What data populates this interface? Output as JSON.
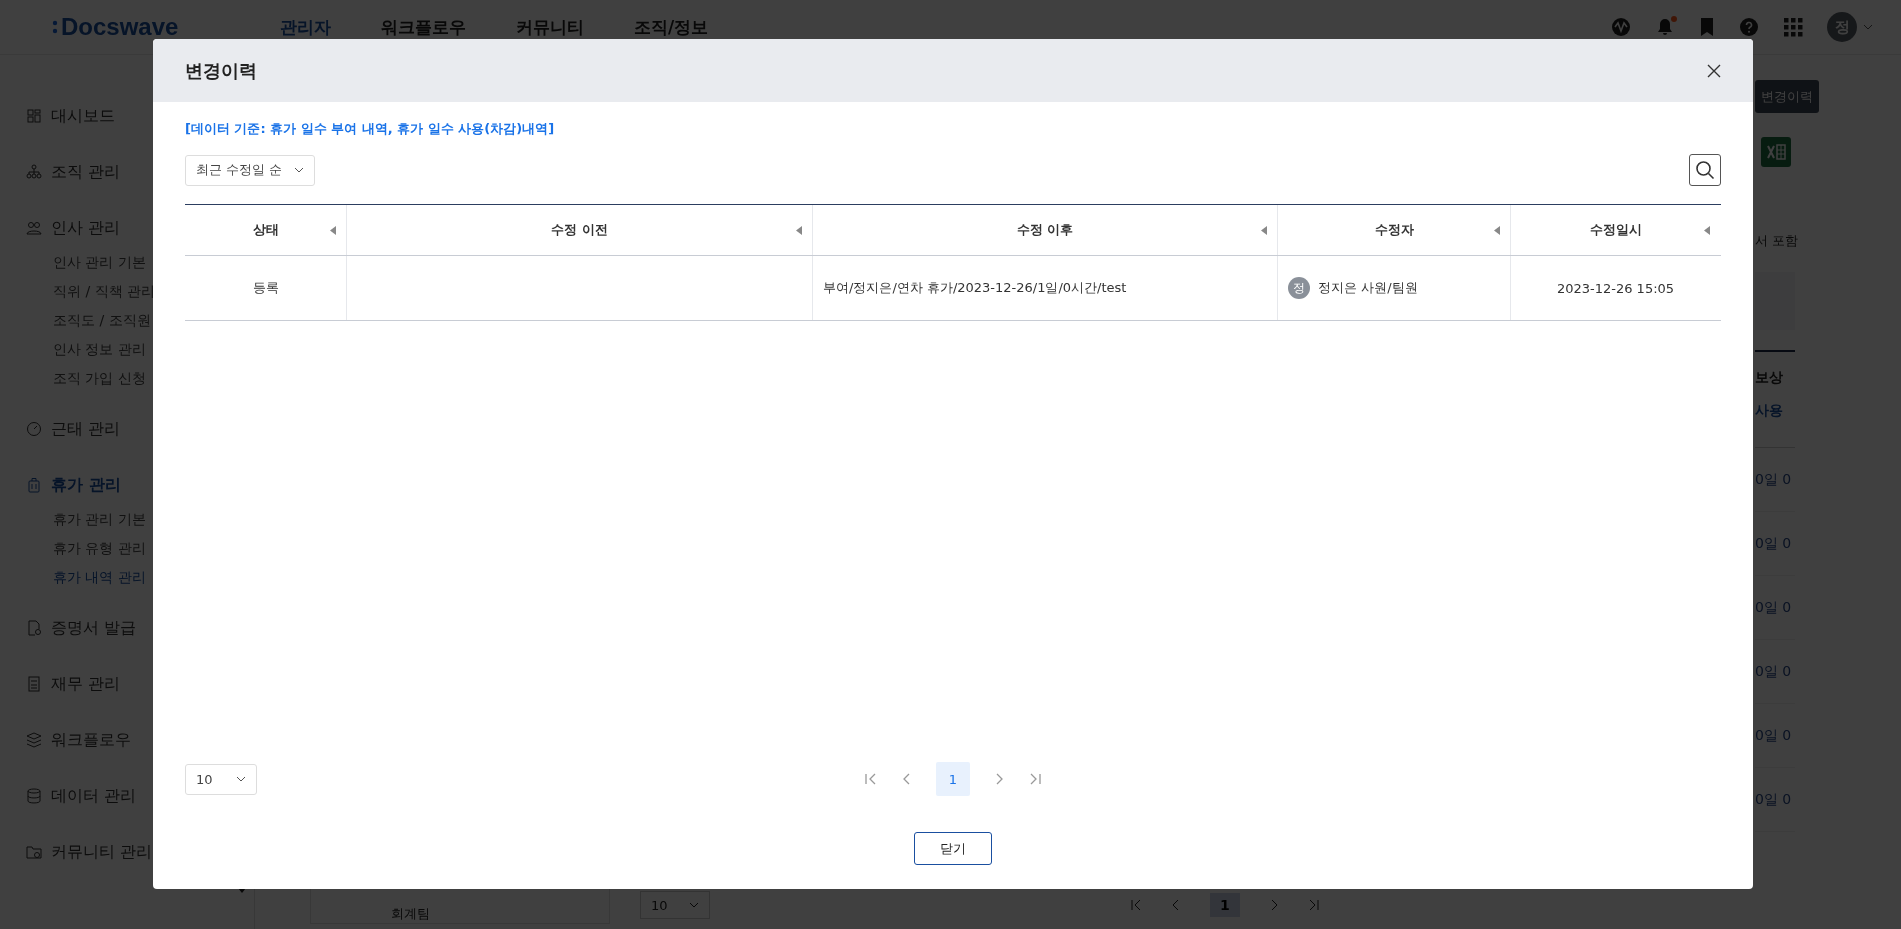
{
  "header": {
    "logo": "Docswave",
    "nav": [
      {
        "label": "관리자",
        "selected": true
      },
      {
        "label": "워크플로우",
        "selected": false
      },
      {
        "label": "커뮤니티",
        "selected": false
      },
      {
        "label": "조직/정보",
        "selected": false
      }
    ],
    "bell_badge": true,
    "avatar_initial": "정"
  },
  "sidebar": {
    "items": [
      {
        "label": "대시보드",
        "selected": false
      },
      {
        "label": "조직 관리",
        "selected": false
      },
      {
        "label": "인사 관리",
        "selected": false,
        "children": [
          {
            "label": "인사 관리 기본",
            "selected": false
          },
          {
            "label": "직위 / 직책 관리",
            "selected": false
          },
          {
            "label": "조직도 / 조직원",
            "selected": false
          },
          {
            "label": "인사 정보 관리",
            "selected": false
          },
          {
            "label": "조직 가입 신청",
            "selected": false
          }
        ]
      },
      {
        "label": "근태 관리",
        "selected": false
      },
      {
        "label": "휴가 관리",
        "selected": true,
        "children": [
          {
            "label": "휴가 관리 기본",
            "selected": false
          },
          {
            "label": "휴가 유형 관리",
            "selected": false
          },
          {
            "label": "휴가 내역 관리",
            "selected": true
          }
        ]
      },
      {
        "label": "증명서 발급",
        "selected": false
      },
      {
        "label": "재무 관리",
        "selected": false
      },
      {
        "label": "워크플로우",
        "selected": false
      },
      {
        "label": "데이터 관리",
        "selected": false
      },
      {
        "label": "커뮤니티 관리",
        "selected": false
      }
    ]
  },
  "page": {
    "history_button": "변경이력",
    "filter_text": "서 포함",
    "column": "보상",
    "subcolumn": "사용",
    "cells": [
      "0일 0",
      "0일 0",
      "0일 0",
      "0일 0",
      "0일 0",
      "0일 0"
    ],
    "team_cell": "회계팀",
    "page_size": "10",
    "pages": [
      {
        "label": "1",
        "selected": true
      }
    ]
  },
  "modal": {
    "title": "변경이력",
    "note": "[데이터 기준: 휴가 일수 부여 내역, 휴가 일수 사용(차감)내역]",
    "sort": "최근 수정일 순",
    "columns": [
      "상태",
      "수정 이전",
      "수정 이후",
      "수정자",
      "수정일시"
    ],
    "rows": [
      {
        "status": "등록",
        "after": "부여/정지은/연차 휴가/2023-12-26/1일/0시간/test",
        "editor_initial": "정",
        "editor": "정지은 사원/팀원",
        "date": "2023-12-26 15:05"
      }
    ],
    "per_page": "10",
    "pages": [
      {
        "label": "1",
        "selected": true
      }
    ],
    "close_button": "닫기"
  }
}
